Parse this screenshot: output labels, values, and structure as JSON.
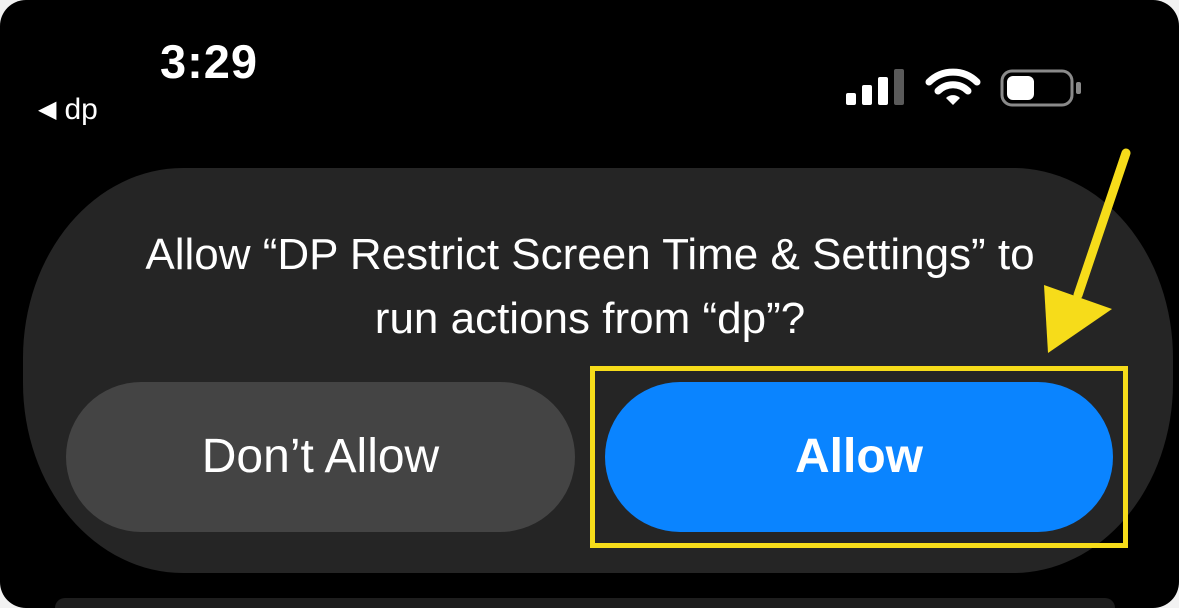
{
  "status_bar": {
    "time": "3:29",
    "back_label": "dp",
    "signal_icon": "cellular-signal-icon",
    "wifi_icon": "wifi-icon",
    "battery_icon": "battery-icon",
    "battery_level": 0.45
  },
  "dialog": {
    "message": "Allow “DP Restrict Screen Time & Settings” to run actions from “dp”?",
    "buttons": {
      "dont_allow": "Don’t Allow",
      "allow": "Allow"
    }
  },
  "annotation": {
    "color": "#f6dc1a",
    "arrow_icon": "arrow-pointer-icon"
  },
  "colors": {
    "allow_blue": "#0a84ff",
    "dialog_background": "#252525",
    "dont_allow_gray": "#444444",
    "screen_black": "#000000"
  }
}
